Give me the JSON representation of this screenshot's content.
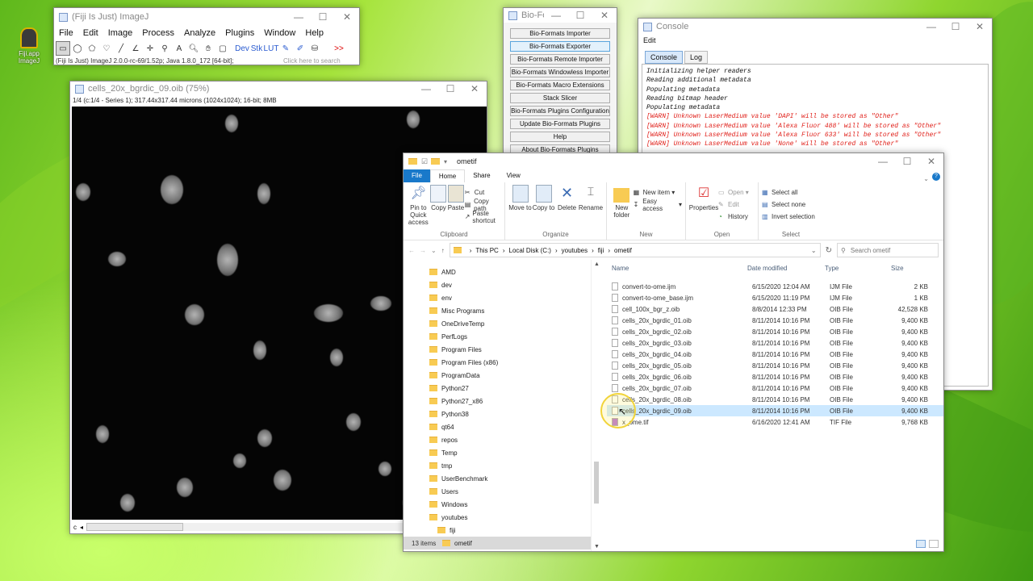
{
  "desktop": {
    "icon_label": "Fiji.app ImageJ"
  },
  "imagej": {
    "title": "(Fiji Is Just) ImageJ",
    "menu": [
      "File",
      "Edit",
      "Image",
      "Process",
      "Analyze",
      "Plugins",
      "Window",
      "Help"
    ],
    "status": "(Fiji Is Just) ImageJ 2.0.0-rc-69/1.52p; Java 1.8.0_172 [64-bit];",
    "search_placeholder": "Click here to search",
    "tool_dev": "Dev",
    "tool_stk": "Stk",
    "tool_lut": "LUT",
    "tool_more": ">>"
  },
  "image_window": {
    "title": "cells_20x_bgrdic_09.oib (75%)",
    "info": "1/4 (c:1/4 - Series 1); 317.44x317.44 microns (1024x1024); 16-bit; 8MB",
    "slider_label": "c"
  },
  "bioformats": {
    "title": "Bio-Fo...",
    "buttons": [
      "Bio-Formats Importer",
      "Bio-Formats Exporter",
      "Bio-Formats Remote Importer",
      "Bio-Formats Windowless Importer",
      "Bio-Formats Macro Extensions",
      "Stack Slicer",
      "Bio-Formats Plugins Configuration",
      "Update Bio-Formats Plugins",
      "Help",
      "About Bio-Formats Plugins"
    ],
    "active_index": 1
  },
  "console": {
    "title": "Console",
    "menu": "Edit",
    "tabs": [
      "Console",
      "Log"
    ],
    "lines": [
      {
        "text": "Initializing helper readers",
        "warn": false
      },
      {
        "text": "Reading additional metadata",
        "warn": false
      },
      {
        "text": "Populating metadata",
        "warn": false
      },
      {
        "text": "Reading bitmap header",
        "warn": false
      },
      {
        "text": "Populating metadata",
        "warn": false
      },
      {
        "text": "[WARN] Unknown LaserMedium value 'DAPI' will be stored as \"Other\"",
        "warn": true
      },
      {
        "text": "[WARN] Unknown LaserMedium value 'Alexa Fluor 488' will be stored as \"Other\"",
        "warn": true
      },
      {
        "text": "[WARN] Unknown LaserMedium value 'Alexa Fluor 633' will be stored as \"Other\"",
        "warn": true
      },
      {
        "text": "[WARN] Unknown LaserMedium value 'None' will be stored as \"Other\"",
        "warn": true
      }
    ],
    "warn_color": "#e0201a"
  },
  "explorer": {
    "title": "ometif",
    "tabs": [
      "File",
      "Home",
      "Share",
      "View"
    ],
    "clipboard": {
      "pin": "Pin to Quick access",
      "copy": "Copy",
      "paste": "Paste",
      "cut": "Cut",
      "copy_path": "Copy path",
      "paste_shortcut": "Paste shortcut",
      "label": "Clipboard"
    },
    "organize": {
      "move": "Move to",
      "copy": "Copy to",
      "delete": "Delete",
      "rename": "Rename",
      "label": "Organize"
    },
    "new": {
      "folder": "New folder",
      "item": "New item",
      "easy": "Easy access",
      "label": "New"
    },
    "open": {
      "props": "Properties",
      "open": "Open",
      "edit": "Edit",
      "history": "History",
      "label": "Open"
    },
    "select": {
      "all": "Select all",
      "none": "Select none",
      "invert": "Invert selection",
      "label": "Select"
    },
    "breadcrumb": [
      "This PC",
      "Local Disk (C:)",
      "youtubes",
      "fiji",
      "ometif"
    ],
    "search_placeholder": "Search ometif",
    "tree": [
      "AMD",
      "dev",
      "env",
      "Misc Programs",
      "OneDriveTemp",
      "PerfLogs",
      "Program Files",
      "Program Files (x86)",
      "ProgramData",
      "Python27",
      "Python27_x86",
      "Python38",
      "qt64",
      "repos",
      "Temp",
      "tmp",
      "UserBenchmark",
      "Users",
      "Windows",
      "youtubes",
      "fiji",
      "ometif"
    ],
    "columns": [
      "Name",
      "Date modified",
      "Type",
      "Size"
    ],
    "files": [
      {
        "name": "convert-to-ome.ijm",
        "date": "6/15/2020 12:04 AM",
        "type": "IJM File",
        "size": "2 KB"
      },
      {
        "name": "convert-to-ome_base.ijm",
        "date": "6/15/2020 11:19 PM",
        "type": "IJM File",
        "size": "1 KB"
      },
      {
        "name": "cell_100x_bgr_z.oib",
        "date": "8/8/2014 12:33 PM",
        "type": "OIB File",
        "size": "42,528 KB"
      },
      {
        "name": "cells_20x_bgrdic_01.oib",
        "date": "8/11/2014 10:16 PM",
        "type": "OIB File",
        "size": "9,400 KB"
      },
      {
        "name": "cells_20x_bgrdic_02.oib",
        "date": "8/11/2014 10:16 PM",
        "type": "OIB File",
        "size": "9,400 KB"
      },
      {
        "name": "cells_20x_bgrdic_03.oib",
        "date": "8/11/2014 10:16 PM",
        "type": "OIB File",
        "size": "9,400 KB"
      },
      {
        "name": "cells_20x_bgrdic_04.oib",
        "date": "8/11/2014 10:16 PM",
        "type": "OIB File",
        "size": "9,400 KB"
      },
      {
        "name": "cells_20x_bgrdic_05.oib",
        "date": "8/11/2014 10:16 PM",
        "type": "OIB File",
        "size": "9,400 KB"
      },
      {
        "name": "cells_20x_bgrdic_06.oib",
        "date": "8/11/2014 10:16 PM",
        "type": "OIB File",
        "size": "9,400 KB"
      },
      {
        "name": "cells_20x_bgrdic_07.oib",
        "date": "8/11/2014 10:16 PM",
        "type": "OIB File",
        "size": "9,400 KB"
      },
      {
        "name": "cells_20x_bgrdic_08.oib",
        "date": "8/11/2014 10:16 PM",
        "type": "OIB File",
        "size": "9,400 KB"
      },
      {
        "name": "cells_20x_bgrdic_09.oib",
        "date": "8/11/2014 10:16 PM",
        "type": "OIB File",
        "size": "9,400 KB"
      },
      {
        "name": "x_ome.tif",
        "date": "6/16/2020 12:41 AM",
        "type": "TIF File",
        "size": "9,768 KB"
      }
    ],
    "selected_index": 11,
    "status": "13 items"
  }
}
